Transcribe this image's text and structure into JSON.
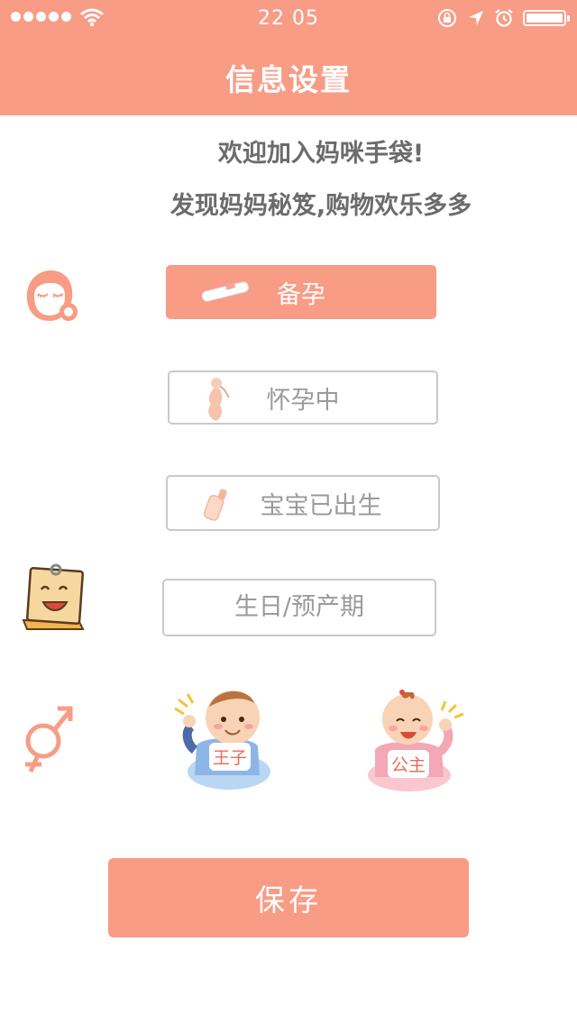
{
  "status_bar": {
    "time": "22 05"
  },
  "header": {
    "title": "信息设置"
  },
  "welcome": {
    "line1": "欢迎加入妈咪手袋!",
    "line2": "发现妈妈秘笈,购物欢乐多多"
  },
  "stages": {
    "trying": "备孕",
    "pregnant": "怀孕中",
    "born": "宝宝已出生"
  },
  "birthday": {
    "placeholder": "生日/预产期"
  },
  "gender": {
    "boy": "王子",
    "girl": "公主"
  },
  "save_label": "保存",
  "colors": {
    "accent": "#f89c86",
    "border": "#c9c9c9",
    "text_gray": "#9a9a9a"
  }
}
